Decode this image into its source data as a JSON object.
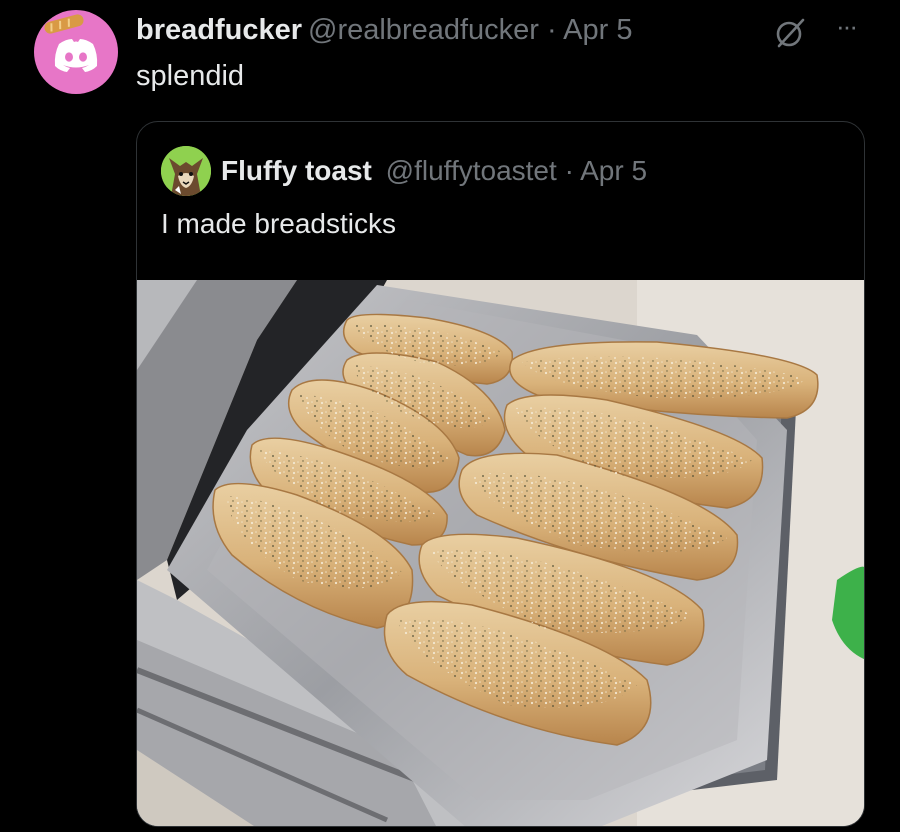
{
  "tweet": {
    "author_name": "breadfucker",
    "author_handle": "@realbreadfucker",
    "separator": "·",
    "date": "Apr 5",
    "text": "splendid",
    "more_label": "···"
  },
  "quote": {
    "author_name": "Fluffy toast",
    "author_handle": "@fluffytoastet",
    "separator": "·",
    "date": "Apr 5",
    "text": "I made breadsticks"
  },
  "colors": {
    "background": "#000000",
    "text_primary": "#e7e9ea",
    "text_secondary": "#71767b",
    "avatar_pink": "#e776c7",
    "quote_avatar_green": "#8fd14f",
    "border": "#2f3336"
  },
  "icons": {
    "avatar": "discord-logo-icon",
    "grok": "grok-icon",
    "more": "more-options-icon"
  }
}
